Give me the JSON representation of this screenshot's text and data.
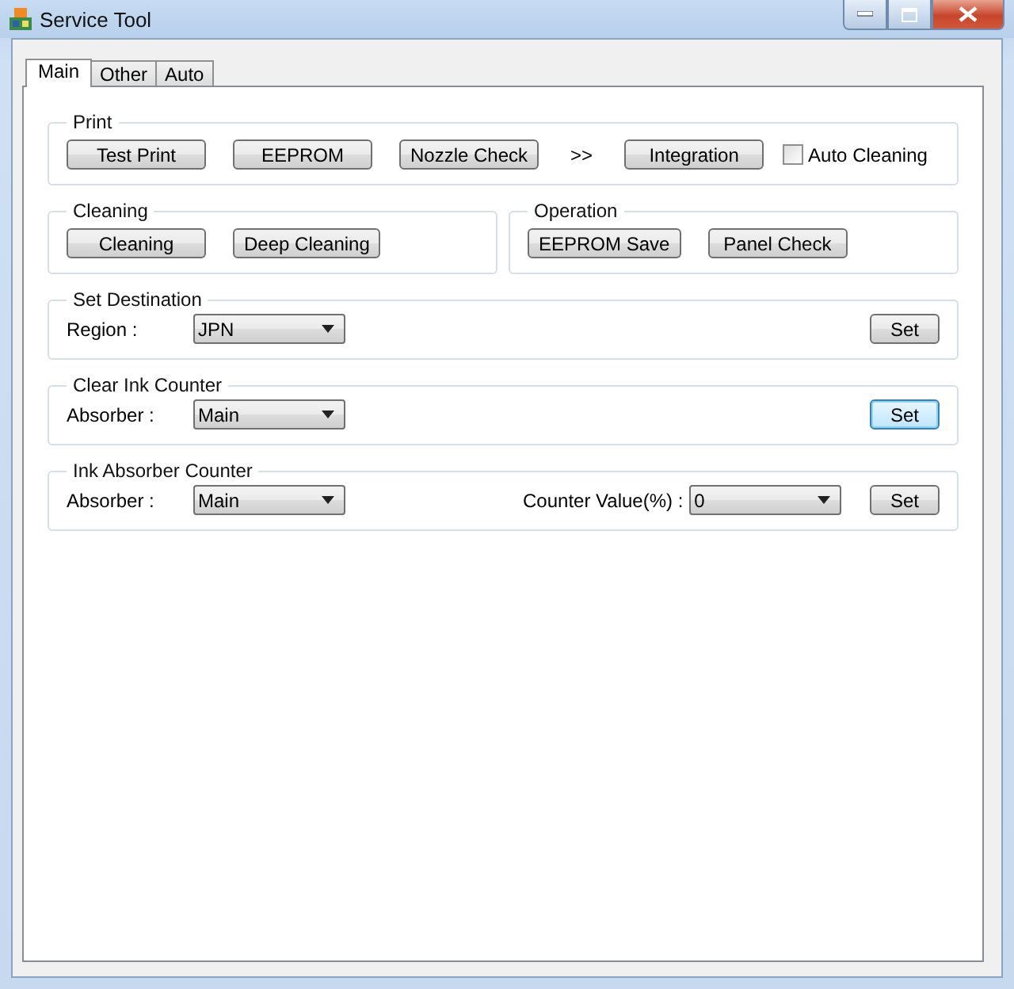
{
  "window": {
    "title": "Service Tool"
  },
  "tabs": [
    {
      "label": "Main",
      "selected": true
    },
    {
      "label": "Other",
      "selected": false
    },
    {
      "label": "Auto",
      "selected": false
    }
  ],
  "rows": [
    [
      {
        "kind": "buttons",
        "title": "Print",
        "items": [
          {
            "kind": "button",
            "label": "Test Print"
          },
          {
            "kind": "button",
            "label": "EEPROM"
          },
          {
            "kind": "button",
            "label": "Nozzle Check"
          },
          {
            "kind": "text",
            "text": ">>"
          },
          {
            "kind": "button",
            "label": "Integration"
          },
          {
            "kind": "checkbox",
            "label": "Auto Cleaning",
            "checked": false
          }
        ]
      }
    ],
    [
      {
        "kind": "buttons",
        "title": "Cleaning",
        "items": [
          {
            "kind": "button",
            "label": "Cleaning"
          },
          {
            "kind": "button",
            "label": "Deep Cleaning"
          }
        ]
      },
      {
        "kind": "buttons",
        "title": "Operation",
        "items": [
          {
            "kind": "button",
            "label": "EEPROM Save"
          },
          {
            "kind": "button",
            "label": "Panel Check"
          }
        ]
      }
    ],
    [
      {
        "kind": "form",
        "title": "Set Destination",
        "fields": [
          {
            "label": "Region :",
            "value": "JPN"
          }
        ],
        "set_button": {
          "label": "Set",
          "focused": false
        }
      }
    ],
    [
      {
        "kind": "form",
        "title": "Clear Ink Counter",
        "fields": [
          {
            "label": "Absorber :",
            "value": "Main"
          }
        ],
        "set_button": {
          "label": "Set",
          "focused": true
        }
      }
    ],
    [
      {
        "kind": "form",
        "title": "Ink Absorber Counter",
        "fields": [
          {
            "label": "Absorber :",
            "value": "Main"
          },
          {
            "label": "Counter Value(%) :",
            "value": "0"
          }
        ],
        "set_button": {
          "label": "Set",
          "focused": false
        }
      }
    ]
  ]
}
